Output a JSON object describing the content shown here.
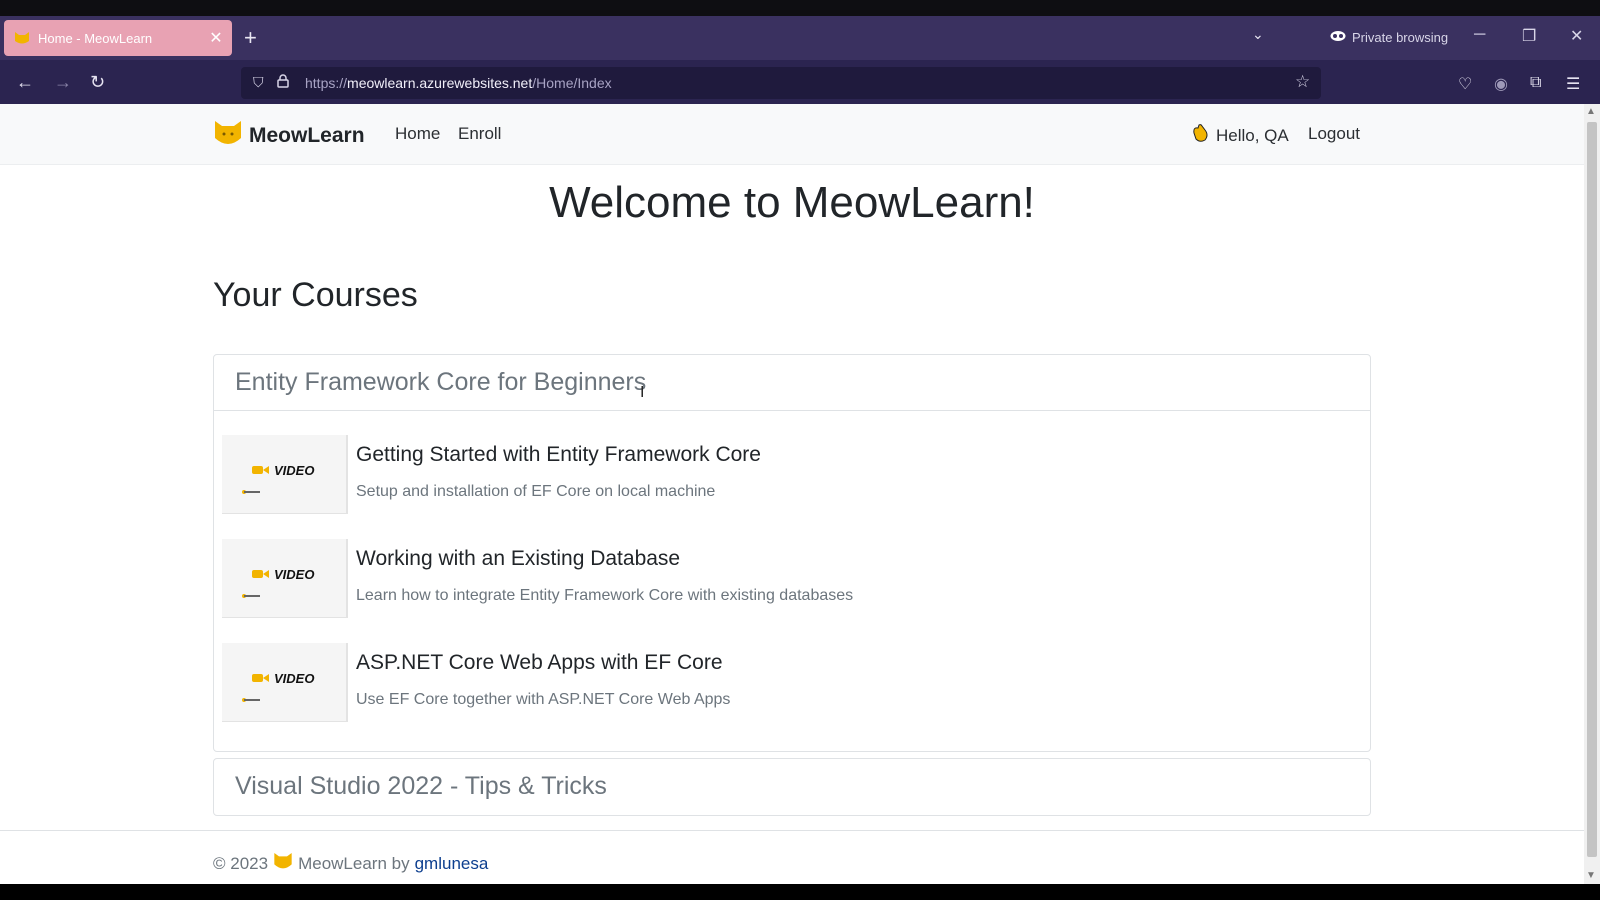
{
  "browser": {
    "tab": {
      "title": "Home - MeowLearn",
      "close_glyph": "✕"
    },
    "new_tab_glyph": "+",
    "tab_list_glyph": "⌄",
    "private_label": "Private browsing",
    "window_controls": {
      "minimize": "─",
      "restore": "❐",
      "close": "✕"
    },
    "nav": {
      "back": "←",
      "forward": "→",
      "reload": "↻"
    },
    "url": {
      "scheme": "https://",
      "host": "meowlearn.azurewebsites.net",
      "path": "/Home/Index"
    },
    "icons": {
      "shield": "⛉",
      "lock": "🔒",
      "star": "☆",
      "pocket": "♡",
      "extensions": "⧉",
      "menu": "☰",
      "account": "◉"
    }
  },
  "site": {
    "brand": "MeowLearn",
    "nav_links": [
      "Home",
      "Enroll"
    ],
    "greeting": "Hello, QA",
    "logout": "Logout"
  },
  "main": {
    "welcome": "Welcome to MeowLearn!",
    "section_title": "Your Courses",
    "courses": [
      {
        "title": "Entity Framework Core for Beginners",
        "lessons": [
          {
            "thumb": "VIDEO",
            "title": "Getting Started with Entity Framework Core",
            "description": "Setup and installation of EF Core on local machine"
          },
          {
            "thumb": "VIDEO",
            "title": "Working with an Existing Database",
            "description": "Learn how to integrate Entity Framework Core with existing databases"
          },
          {
            "thumb": "VIDEO",
            "title": "ASP.NET Core Web Apps with EF Core",
            "description": "Use EF Core together with ASP.NET Core Web Apps"
          }
        ]
      },
      {
        "title": "Visual Studio 2022 - Tips & Tricks",
        "lessons": []
      }
    ]
  },
  "footer": {
    "copyright": "© 2023",
    "brand": "MeowLearn by",
    "author": "gmlunesa"
  },
  "colors": {
    "tab_active": "#e8a2b3",
    "chrome_bg": "#3a3160",
    "link": "#0d3f8f",
    "brand_accent": "#f2b400"
  }
}
